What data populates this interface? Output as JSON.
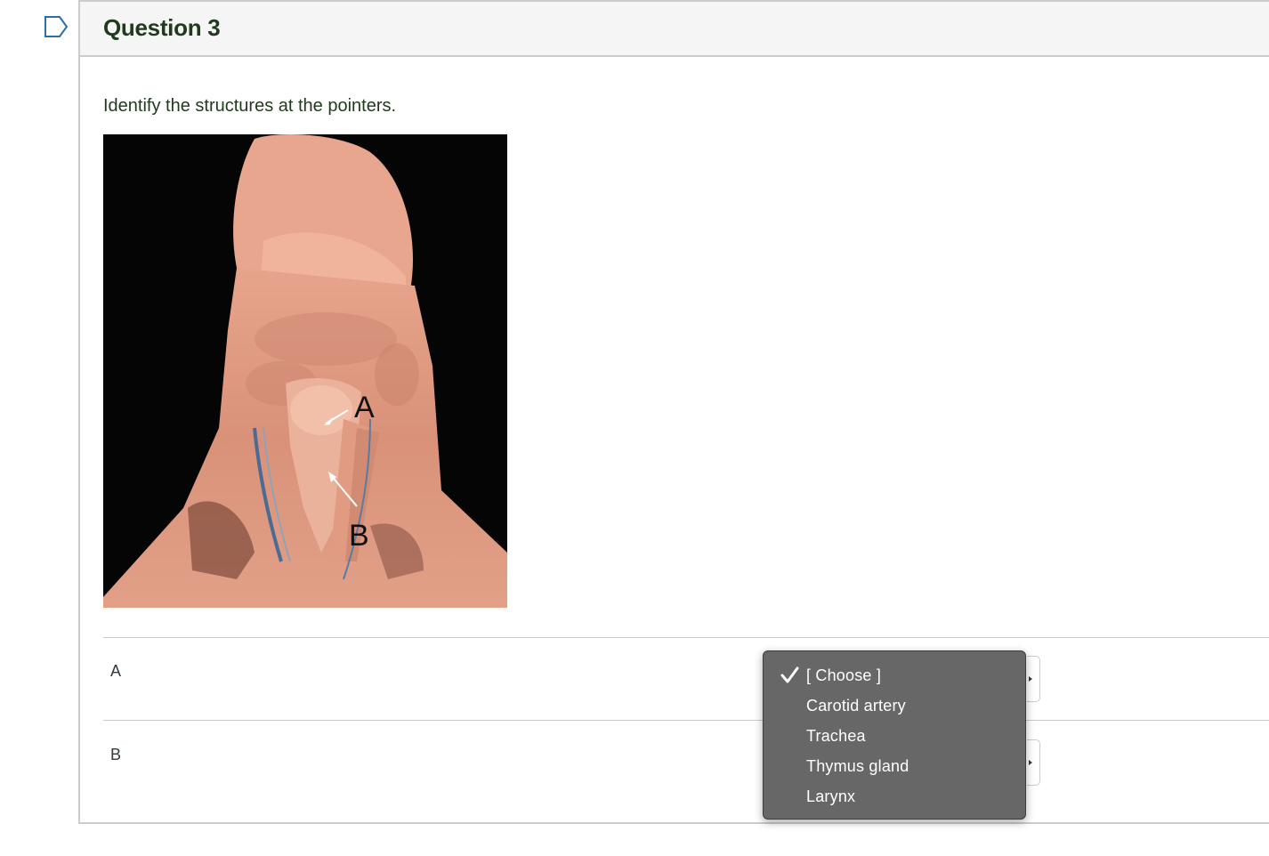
{
  "question": {
    "title": "Question 3",
    "prompt": "Identify the structures at the pointers."
  },
  "image": {
    "labels": [
      "A",
      "B"
    ]
  },
  "answers": {
    "rows": [
      {
        "label": "A"
      },
      {
        "label": "B"
      }
    ]
  },
  "dropdown": {
    "options": [
      "[ Choose ]",
      "Carotid artery",
      "Trachea",
      "Thymus gland",
      "Larynx"
    ],
    "selected": "[ Choose ]"
  },
  "colors": {
    "title_text": "#1f3a1c",
    "border": "#c7cdd1",
    "dropdown_bg": "#676767"
  },
  "icons": {
    "flag": "bookmark-flag-icon",
    "check": "checkmark-icon"
  }
}
